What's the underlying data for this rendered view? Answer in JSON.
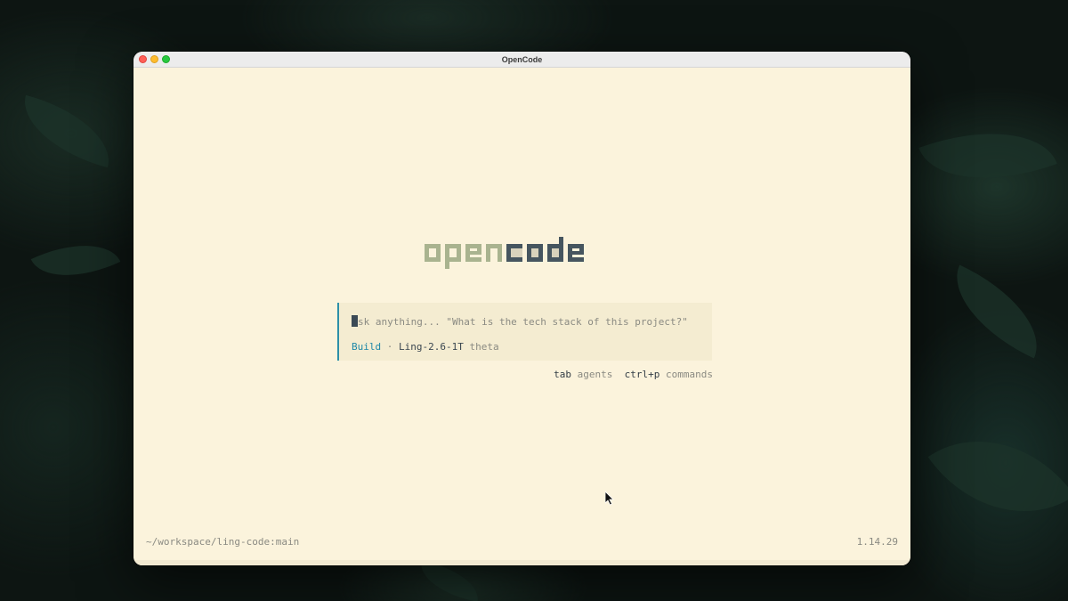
{
  "window": {
    "title": "OpenCode"
  },
  "logo": {
    "text_open": "open",
    "text_code": "code",
    "color_open": "#a9b38f",
    "color_code": "#46555f"
  },
  "prompt": {
    "cursor_char": "A",
    "placeholder_rest": "sk anything... \"What is the tech stack of this project?\"",
    "agent_mode": "Build",
    "separator": "·",
    "model": "Ling-2.6-1T",
    "variant": "theta"
  },
  "hints": [
    {
      "key": "tab",
      "label": "agents"
    },
    {
      "key": "ctrl+p",
      "label": "commands"
    }
  ],
  "footer": {
    "path": "~/workspace/ling-code:main",
    "version": "1.14.29"
  },
  "colors": {
    "accent": "#2d8fa8",
    "background": "#fbf3dc"
  }
}
